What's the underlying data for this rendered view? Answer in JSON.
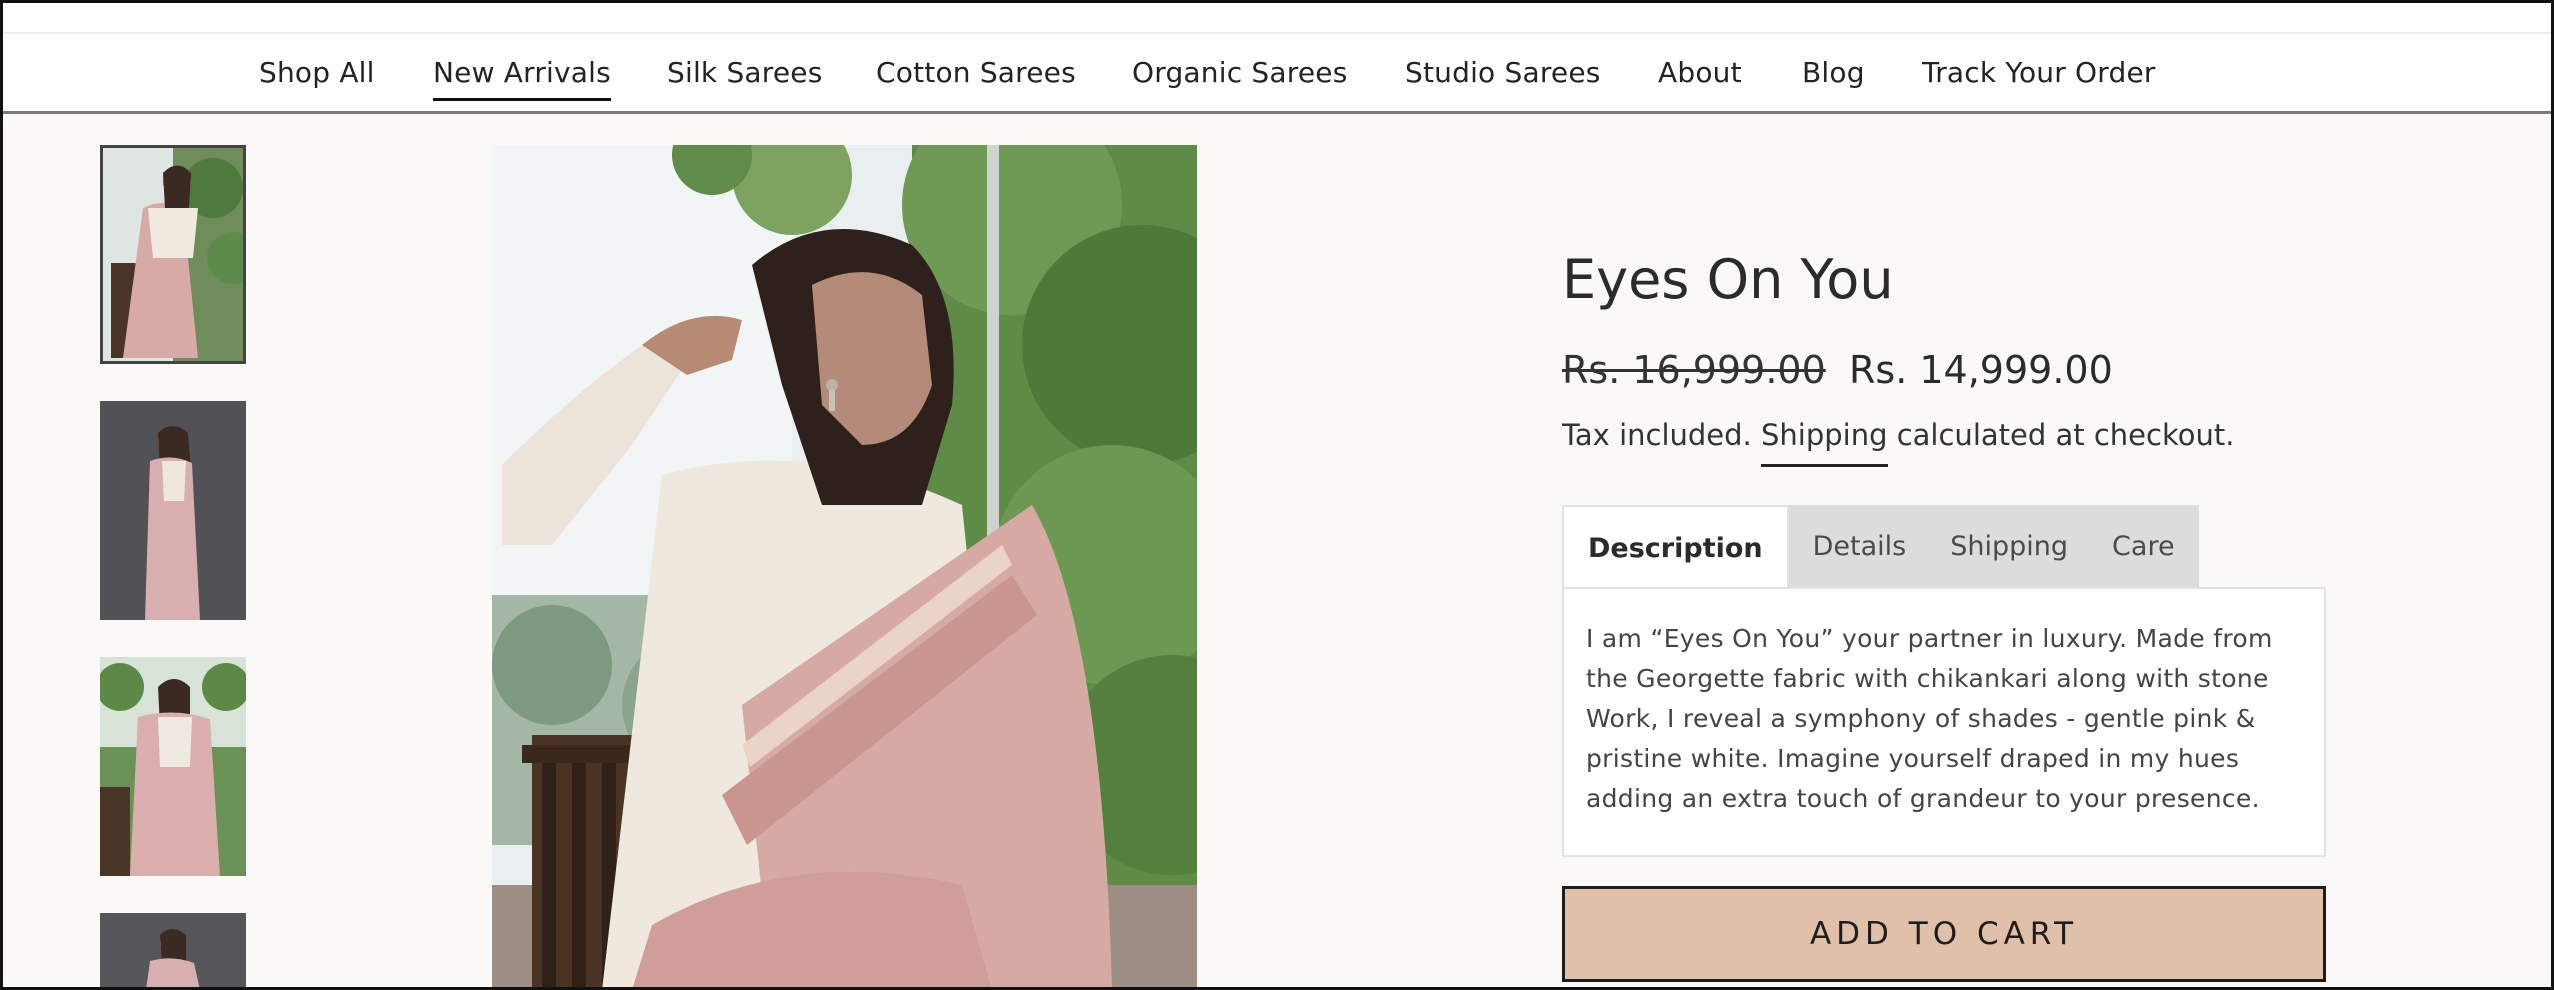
{
  "nav": {
    "items": [
      {
        "label": "Shop All"
      },
      {
        "label": "New Arrivals",
        "active": true
      },
      {
        "label": "Silk Sarees"
      },
      {
        "label": "Cotton Sarees"
      },
      {
        "label": "Organic Sarees"
      },
      {
        "label": "Studio Sarees"
      },
      {
        "label": "About"
      },
      {
        "label": "Blog"
      },
      {
        "label": "Track Your Order"
      }
    ]
  },
  "gallery": {
    "selected_index": 0,
    "thumbnail_count": 4
  },
  "product": {
    "title": "Eyes On You",
    "price_original": "Rs. 16,999.00",
    "price_sale": "Rs. 14,999.00",
    "tax_prefix": "Tax included.",
    "tax_link": "Shipping",
    "tax_suffix": "calculated at checkout."
  },
  "tabs": {
    "items": [
      {
        "label": "Description",
        "active": true
      },
      {
        "label": "Details"
      },
      {
        "label": "Shipping"
      },
      {
        "label": "Care"
      }
    ],
    "description_lines": [
      "I am “Eyes On You” your partner in luxury. Made from",
      "the Georgette fabric with chikankari along with stone",
      "Work, I reveal a symphony of shades - gentle pink &",
      "pristine white. Imagine yourself draped in my hues",
      "adding an extra touch of grandeur to your presence."
    ]
  },
  "cart": {
    "button_label": "ADD TO CART"
  },
  "colors": {
    "accent": "#e0c0a8",
    "page_background": "#faf9f8",
    "saree_pink": "#d6a9a5"
  },
  "icons": []
}
